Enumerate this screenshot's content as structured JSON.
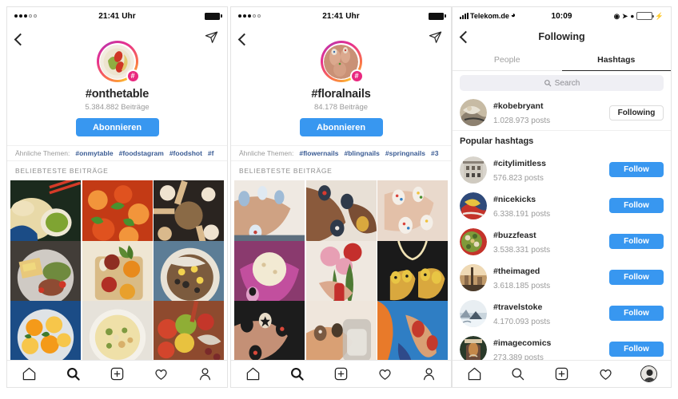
{
  "phone1": {
    "statusbar": {
      "time": "21:41 Uhr",
      "signal_filled": 3,
      "signal_empty": 2
    },
    "topbar": {
      "back": "back-chevron",
      "share": "share-paper-plane"
    },
    "header": {
      "title": "#onthetable",
      "count": "5.384.882 Beiträge",
      "follow_label": "Abonnieren",
      "badge_glyph": "#"
    },
    "related": {
      "label": "Ähnliche Themen:",
      "tags": [
        "#onmytable",
        "#foodstagram",
        "#foodshot",
        "#f"
      ]
    },
    "section_label": "BELIEBTESTE BEITRÄGE",
    "grid": [
      {
        "name": "dumplings-with-green-sauce",
        "c1": "#1b2a1d",
        "c2": "#e8d9a8",
        "c3": "#7fa432",
        "c4": "#d43b28"
      },
      {
        "name": "shrimp-curry-with-cilantro",
        "c1": "#e0521f",
        "c2": "#f2953b",
        "c3": "#49912e",
        "c4": "#c33a15"
      },
      {
        "name": "overhead-table-of-bowls",
        "c1": "#2a2420",
        "c2": "#d9b98c",
        "c3": "#8a6a46",
        "c4": "#efe3d0"
      },
      {
        "name": "plate-with-toast-and-salad",
        "c1": "#cfcac4",
        "c2": "#f0d97f",
        "c3": "#6f8a3e",
        "c4": "#8e4b33"
      },
      {
        "name": "tomatoes-on-cutting-board",
        "c1": "#efe6d3",
        "c2": "#b12f25",
        "c3": "#e88a1c",
        "c4": "#5d8a32"
      },
      {
        "name": "burrito-bowl-with-corn",
        "c1": "#7c5b3e",
        "c2": "#f2d24f",
        "c3": "#2f2a26",
        "c4": "#e8e2d6"
      },
      {
        "name": "bowl-of-oranges",
        "c1": "#1b4c86",
        "c2": "#f49a19",
        "c3": "#f7c64a",
        "c4": "#3e7a2e"
      },
      {
        "name": "risotto-in-white-bowl",
        "c1": "#e6e2da",
        "c2": "#efe0a8",
        "c3": "#7f9a40",
        "c4": "#d8b06a"
      },
      {
        "name": "assorted-fruit-and-veg",
        "c1": "#8e4a2e",
        "c2": "#d3452c",
        "c3": "#8fae35",
        "c4": "#e8c23f"
      }
    ],
    "tabbar": [
      "home-icon",
      "search-icon",
      "add-post-icon",
      "heart-icon",
      "profile-icon"
    ],
    "active_tab": "search-icon"
  },
  "phone2": {
    "statusbar": {
      "time": "21:41 Uhr",
      "signal_filled": 3,
      "signal_empty": 2
    },
    "header": {
      "title": "#floralnails",
      "count": "84.178 Beiträge",
      "follow_label": "Abonnieren",
      "badge_glyph": "#"
    },
    "related": {
      "label": "Ähnliche Themen:",
      "tags": [
        "#flowernails",
        "#blingnails",
        "#springnails",
        "#3"
      ]
    },
    "section_label": "BELIEBTESTE BEITRÄGE",
    "grid": [
      {
        "name": "hand-with-pastel-nails",
        "c1": "#d8c2ae",
        "c2": "#9fbbd6",
        "c3": "#efe9e2",
        "c4": "#5e6f7e"
      },
      {
        "name": "dark-hands-with-floral-nails",
        "c1": "#8a5a3c",
        "c2": "#2f3a4a",
        "c3": "#d93a30",
        "c4": "#e8e0d6"
      },
      {
        "name": "confetti-nail-art",
        "c1": "#e9d9cc",
        "c2": "#f0c23a",
        "c3": "#2f7fc4",
        "c4": "#d9443d"
      },
      {
        "name": "ice-cream-cone-with-nails",
        "c1": "#c24f9e",
        "c2": "#f2ead3",
        "c3": "#e0a0c8",
        "c4": "#8a3a6e"
      },
      {
        "name": "hand-holding-red-flowers",
        "c1": "#efe8e0",
        "c2": "#c42f2c",
        "c3": "#e79fb4",
        "c4": "#4e7a34"
      },
      {
        "name": "yellow-nails-with-gold-chains",
        "c1": "#1a1a1a",
        "c2": "#e8c544",
        "c3": "#d9a83e",
        "c4": "#f0e2b4"
      },
      {
        "name": "black-nails-with-stars",
        "c1": "#1c1c1c",
        "c2": "#e8dcc8",
        "c3": "#d9483a",
        "c4": "#8a6a4e"
      },
      {
        "name": "hand-holding-glass",
        "c1": "#efe6dc",
        "c2": "#d9a074",
        "c3": "#c4bfb8",
        "c4": "#7a5a42"
      },
      {
        "name": "red-nails-against-blue-sky",
        "c1": "#2f7ec4",
        "c2": "#e87a2a",
        "c3": "#c43a2c",
        "c4": "#d9a074"
      }
    ],
    "tabbar": [
      "home-icon",
      "search-icon",
      "add-post-icon",
      "heart-icon",
      "profile-icon"
    ],
    "active_tab": "search-icon"
  },
  "phone3": {
    "statusbar": {
      "carrier": "Telekom.de",
      "time": "10:09",
      "icons": [
        "wifi-icon",
        "rotation-lock-icon",
        "location-arrow-icon",
        "do-not-disturb-icon",
        "battery-icon",
        "charging-bolt-icon"
      ]
    },
    "nav": {
      "title": "Following",
      "back": "back-chevron"
    },
    "tabs": [
      {
        "label": "People",
        "active": false
      },
      {
        "label": "Hashtags",
        "active": true
      }
    ],
    "search": {
      "placeholder": "Search",
      "icon": "search-icon"
    },
    "following_row": {
      "name": "#kobebryant",
      "posts": "1.028.973 posts",
      "button": "Following",
      "avatar": "sneaker-photo"
    },
    "popular_header": "Popular hashtags",
    "popular": [
      {
        "name": "#citylimitless",
        "posts": "576.823 posts",
        "button": "Follow",
        "avatar": "building-photo",
        "c1": "#d8d4cc",
        "c2": "#8a8278",
        "c3": "#4a4642",
        "c4": "#efece6"
      },
      {
        "name": "#nicekicks",
        "posts": "6.338.191 posts",
        "button": "Follow",
        "avatar": "red-sneakers-photo",
        "c1": "#c4332a",
        "c2": "#2f4a7a",
        "c3": "#e8c23f",
        "c4": "#efe8e0"
      },
      {
        "name": "#buzzfeast",
        "posts": "3.538.331 posts",
        "button": "Follow",
        "avatar": "food-platter-photo",
        "c1": "#7f9a3a",
        "c2": "#c4332a",
        "c3": "#e8dcc0",
        "c4": "#4a6a2a"
      },
      {
        "name": "#theimaged",
        "posts": "3.618.185 posts",
        "button": "Follow",
        "avatar": "sunset-city-photo",
        "c1": "#c09a6a",
        "c2": "#8a6a4a",
        "c3": "#efd9b4",
        "c4": "#4a3a2a"
      },
      {
        "name": "#travelstoke",
        "posts": "4.170.093 posts",
        "button": "Follow",
        "avatar": "snowy-landscape-photo",
        "c1": "#c8d4dc",
        "c2": "#8a9aa8",
        "c3": "#e8eef2",
        "c4": "#4a5a68"
      },
      {
        "name": "#imagecomics",
        "posts": "273.389 posts",
        "button": "Follow",
        "avatar": "comic-cover-photo",
        "c1": "#2a3a2a",
        "c2": "#c4884a",
        "c3": "#d9c8a8",
        "c4": "#6a4a3a"
      }
    ],
    "tabbar": [
      "home-icon",
      "search-icon",
      "add-post-icon",
      "heart-icon",
      "profile-avatar"
    ],
    "active_tab": "profile-avatar"
  },
  "colors": {
    "instagram_blue": "#3897f0",
    "text_primary": "#262626",
    "text_secondary": "#9a9a9a",
    "badge_pink": "#e9287f",
    "tag_link": "#3b5c94"
  }
}
